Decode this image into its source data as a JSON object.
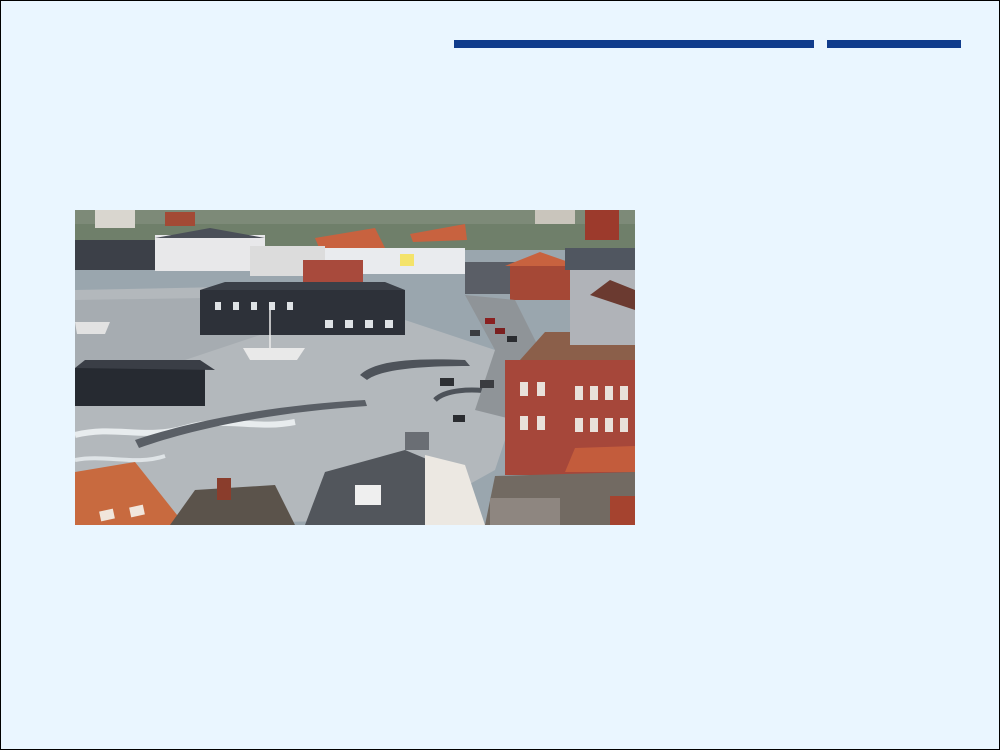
{
  "slide": {
    "background": "#eaf6ff",
    "accent_color": "#103c8c",
    "image": {
      "icon": "photo-icon",
      "subject": "flooded-harbor-town-photo"
    }
  }
}
